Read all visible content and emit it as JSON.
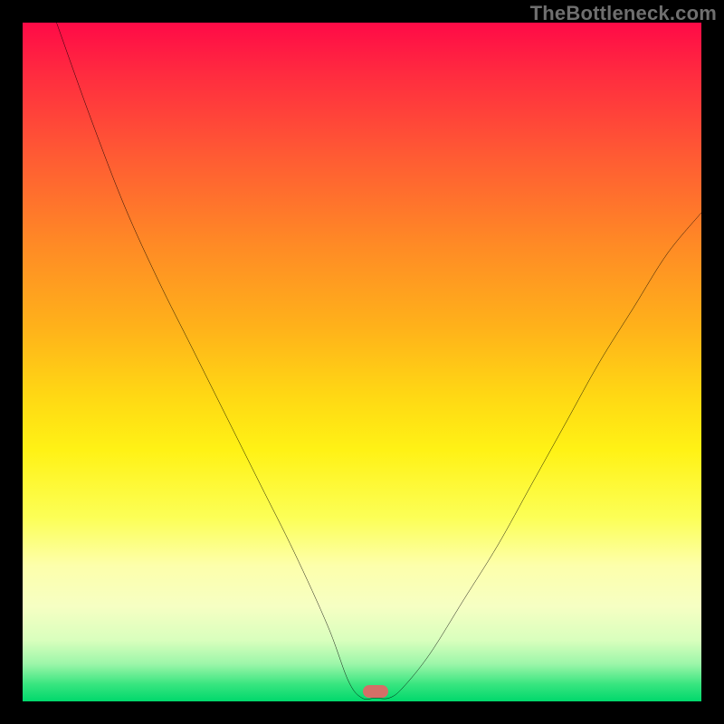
{
  "watermark": "TheBottleneck.com",
  "chart_data": {
    "type": "line",
    "title": "",
    "xlabel": "",
    "ylabel": "",
    "xlim": [
      0,
      100
    ],
    "ylim": [
      0,
      100
    ],
    "marker": {
      "x": 52,
      "y": 1.5,
      "color": "#d56f67"
    },
    "gradient_stops": [
      {
        "pct": 0,
        "color": "#ff0a47"
      },
      {
        "pct": 8,
        "color": "#ff2d3f"
      },
      {
        "pct": 20,
        "color": "#ff5c33"
      },
      {
        "pct": 33,
        "color": "#ff8b25"
      },
      {
        "pct": 45,
        "color": "#ffb21a"
      },
      {
        "pct": 55,
        "color": "#ffd814"
      },
      {
        "pct": 63,
        "color": "#fff215"
      },
      {
        "pct": 73,
        "color": "#fcff57"
      },
      {
        "pct": 80,
        "color": "#fdffab"
      },
      {
        "pct": 86,
        "color": "#f6ffc3"
      },
      {
        "pct": 91,
        "color": "#d9ffbd"
      },
      {
        "pct": 94.5,
        "color": "#9cf6a9"
      },
      {
        "pct": 97.5,
        "color": "#38e57f"
      },
      {
        "pct": 100,
        "color": "#00d86c"
      }
    ],
    "series": [
      {
        "name": "bottleneck-curve",
        "points": [
          {
            "x": 5,
            "y": 100
          },
          {
            "x": 10,
            "y": 86
          },
          {
            "x": 15,
            "y": 73
          },
          {
            "x": 20,
            "y": 62
          },
          {
            "x": 25,
            "y": 52
          },
          {
            "x": 30,
            "y": 42
          },
          {
            "x": 35,
            "y": 32
          },
          {
            "x": 40,
            "y": 22
          },
          {
            "x": 45,
            "y": 11
          },
          {
            "x": 48,
            "y": 3
          },
          {
            "x": 50,
            "y": 0.5
          },
          {
            "x": 52,
            "y": 0.5
          },
          {
            "x": 54,
            "y": 0.5
          },
          {
            "x": 56,
            "y": 2
          },
          {
            "x": 60,
            "y": 7
          },
          {
            "x": 65,
            "y": 15
          },
          {
            "x": 70,
            "y": 23
          },
          {
            "x": 75,
            "y": 32
          },
          {
            "x": 80,
            "y": 41
          },
          {
            "x": 85,
            "y": 50
          },
          {
            "x": 90,
            "y": 58
          },
          {
            "x": 95,
            "y": 66
          },
          {
            "x": 100,
            "y": 72
          }
        ]
      }
    ]
  }
}
